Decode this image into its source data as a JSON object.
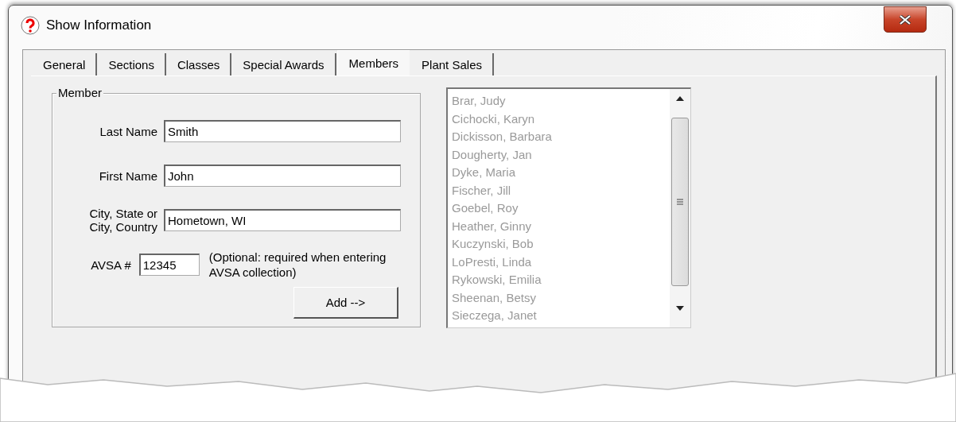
{
  "window": {
    "title": "Show Information"
  },
  "tabs": [
    {
      "label": "General",
      "selected": false
    },
    {
      "label": "Sections",
      "selected": false
    },
    {
      "label": "Classes",
      "selected": false
    },
    {
      "label": "Special Awards",
      "selected": false
    },
    {
      "label": "Members",
      "selected": true
    },
    {
      "label": "Plant Sales",
      "selected": false
    }
  ],
  "member_group": {
    "title": "Member",
    "fields": [
      {
        "label": "Last Name",
        "value": "Smith",
        "kind": "wide"
      },
      {
        "label": "First Name",
        "value": "John",
        "kind": "wide"
      },
      {
        "label": "City, State or City, Country",
        "value": "Hometown, WI",
        "kind": "wide"
      },
      {
        "label": "AVSA #",
        "value": "12345",
        "kind": "short",
        "note": "(Optional: required when entering AVSA collection)"
      }
    ],
    "add_button": "Add -->"
  },
  "member_list": [
    "Brar, Judy",
    "Cichocki, Karyn",
    "Dickisson, Barbara",
    "Dougherty, Jan",
    "Dyke, Maria",
    "Fischer, Jill",
    "Goebel, Roy",
    "Heather, Ginny",
    "Kuczynski, Bob",
    "LoPresti, Linda",
    "Rykowski, Emilia",
    "Sheenan, Betsy",
    "Sieczega, Janet"
  ]
}
